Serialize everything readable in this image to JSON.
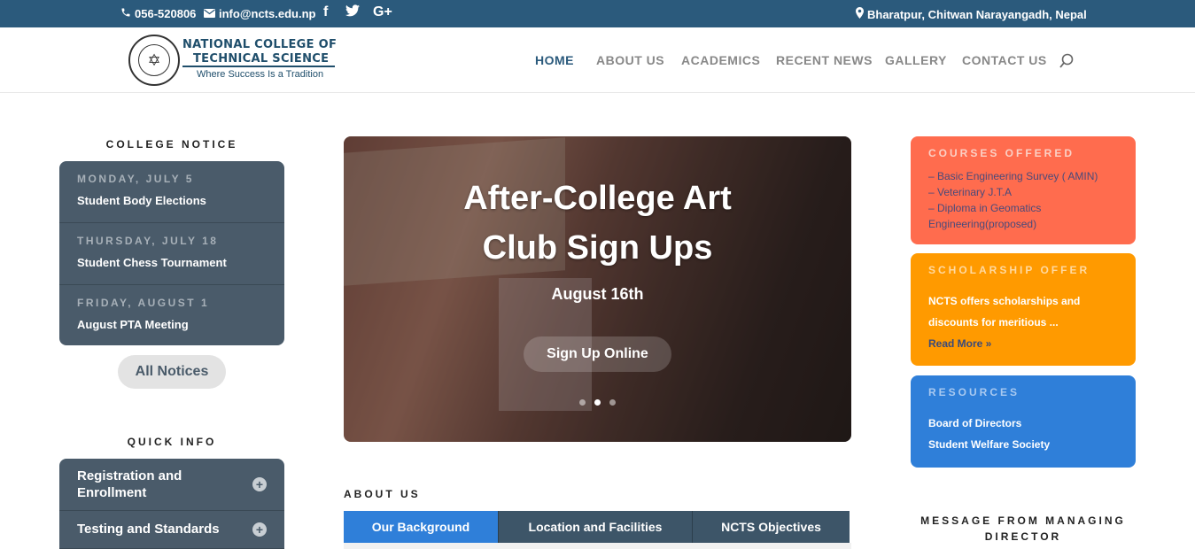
{
  "topbar": {
    "phone": "056-520806",
    "email": "info@ncts.edu.np",
    "social": [
      "f",
      "t",
      "G+"
    ],
    "address": "Bharatpur, Chitwan Narayangadh, Nepal"
  },
  "header": {
    "logo_line1": "NATIONAL COLLEGE OF",
    "logo_line2": "TECHNICAL SCIENCE",
    "logo_tagline": "Where Success Is a Tradition",
    "nav": [
      "HOME",
      "ABOUT US",
      "ACADEMICS",
      "RECENT NEWS",
      "GALLERY",
      "CONTACT US"
    ],
    "active_nav": "HOME"
  },
  "college_notice": {
    "title": "COLLEGE NOTICE",
    "items": [
      {
        "date": "MONDAY, JULY 5",
        "name": "Student Body Elections"
      },
      {
        "date": "THURSDAY, JULY 18",
        "name": "Student Chess Tournament"
      },
      {
        "date": "FRIDAY, AUGUST 1",
        "name": "August PTA Meeting"
      }
    ],
    "button": "All Notices"
  },
  "quick_info": {
    "title": "QUICK INFO",
    "items": [
      "Registration and Enrollment",
      "Testing and Standards"
    ]
  },
  "slider": {
    "title_line1": "After-College Art",
    "title_line2": "Club Sign Ups",
    "subtitle": "August 16th",
    "button": "Sign Up Online"
  },
  "about": {
    "title": "ABOUT US",
    "tabs": [
      "Our Background",
      "Location and Facilities",
      "NCTS Objectives"
    ]
  },
  "courses": {
    "title": "COURSES OFFERED",
    "lines": [
      "– Basic Engineering Survey ( AMIN)",
      "– Veterinary J.T.A",
      "– Diploma in Geomatics",
      "Engineering(proposed)"
    ]
  },
  "scholarship": {
    "title": "SCHOLARSHIP OFFER",
    "lines": [
      "NCTS offers scholarships and",
      "discounts for meritious ..."
    ],
    "link": "Read More »"
  },
  "resources": {
    "title": "RESOURCES",
    "links": [
      "Board of Directors",
      "Student Welfare Society"
    ]
  },
  "message": {
    "title_line1": "MESSAGE FROM MANAGING",
    "title_line2": "DIRECTOR"
  },
  "colors": {
    "topbar": "#2b5a7c",
    "notice_box": "#4a5b6a",
    "courses": "#ff6c4e",
    "scholarship": "#ff9a00",
    "resources": "#2f7fd9"
  }
}
